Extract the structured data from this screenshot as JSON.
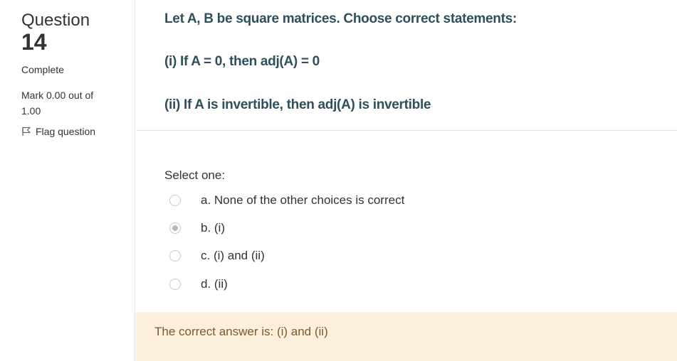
{
  "info": {
    "question_word": "Question",
    "question_number": "14",
    "state": "Complete",
    "grade": "Mark 0.00 out of 1.00",
    "flag_label": "Flag question"
  },
  "question": {
    "lines": [
      "Let A, B be square matrices. Choose correct statements:",
      "(i) If A = 0, then adj(A) = 0",
      "(ii) If A is invertible, then adj(A) is invertible"
    ]
  },
  "answer": {
    "prompt": "Select one:",
    "options": [
      {
        "label": "a. None of the other choices is correct",
        "checked": false
      },
      {
        "label": "b. (i)",
        "checked": true
      },
      {
        "label": "c. (i) and (ii)",
        "checked": false
      },
      {
        "label": "d. (ii)",
        "checked": false
      }
    ]
  },
  "feedback": {
    "text": "The correct answer is: (i) and (ii)"
  },
  "colors": {
    "question_text": "#2e4f5b",
    "feedback_bg": "#fcefdc",
    "feedback_text": "#7d5a29"
  },
  "icons": {
    "flag": "flag-icon"
  }
}
